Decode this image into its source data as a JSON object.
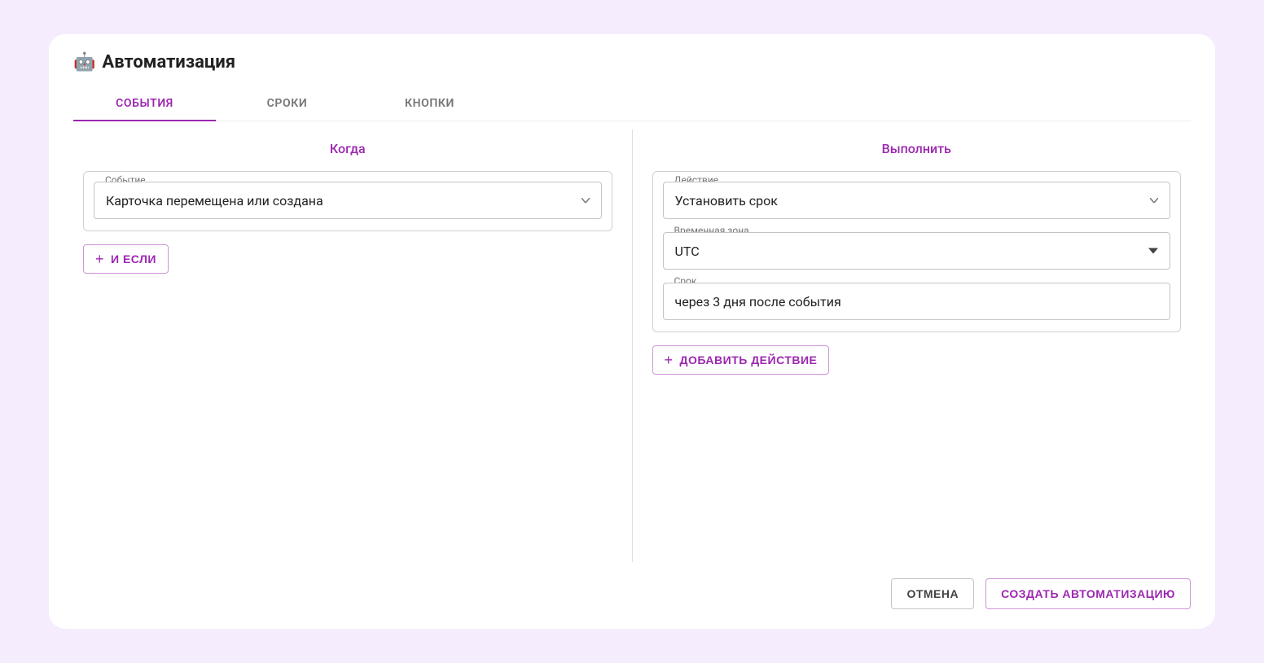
{
  "title": "Автоматизация",
  "title_emoji": "🤖",
  "tabs": {
    "events": "СОБЫТИЯ",
    "deadlines": "СРОКИ",
    "buttons": "КНОПКИ"
  },
  "when": {
    "heading": "Когда",
    "event_label": "Событие",
    "event_value": "Карточка перемещена или создана",
    "and_if_label": "И ЕСЛИ"
  },
  "do": {
    "heading": "Выполнить",
    "action_label": "Действие",
    "action_value": "Установить срок",
    "timezone_label": "Временная зона",
    "timezone_value": "UTC",
    "deadline_label": "Срок",
    "deadline_value": "через 3 дня после события",
    "add_action_label": "ДОБАВИТЬ ДЕЙСТВИЕ"
  },
  "footer": {
    "cancel": "ОТМЕНА",
    "create": "СОЗДАТЬ АВТОМАТИЗАЦИЮ"
  }
}
